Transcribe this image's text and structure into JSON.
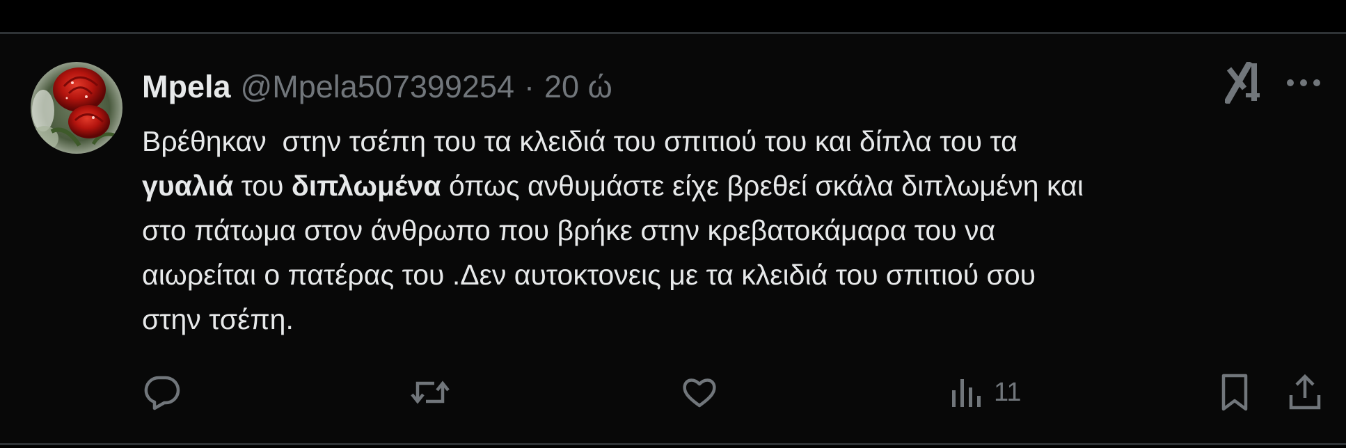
{
  "author": {
    "display_name": "Mpela",
    "handle": "@Mpela507399254",
    "separator": "·",
    "time": "20 ώ"
  },
  "tweet": {
    "segments": [
      {
        "text": "Βρέθηκαν  στην τσέπη του τα κλειδιά του σπιτιού του και δίπλα του τα\n",
        "bold": false
      },
      {
        "text": "γυαλιά",
        "bold": true
      },
      {
        "text": " του ",
        "bold": false
      },
      {
        "text": "διπλωμένα",
        "bold": true
      },
      {
        "text": " όπως ανθυμάστε είχε βρεθεί σκάλα διπλωμένη και\nστο πάτωμα στον άνθρωπο που βρήκε στην κρεβατοκάμαρα του να\nαιωρείται ο πατέρας του .Δεν αυτοκτονεις με τα κλειδιά του σπιτιού σου\nστην τσέπη.",
        "bold": false
      }
    ]
  },
  "actions": {
    "views_count": "11"
  },
  "icons": {
    "avatar": "red-rose-avatar",
    "grok": "grok-icon",
    "more": "more-icon",
    "reply": "reply-icon",
    "repost": "repost-icon",
    "like": "like-icon",
    "views": "views-icon",
    "bookmark": "bookmark-icon",
    "share": "share-icon"
  },
  "colors": {
    "background": "#000000",
    "card": "#080808",
    "text": "#e7e9ea",
    "secondary": "#71767b",
    "divider": "#2f3336"
  }
}
